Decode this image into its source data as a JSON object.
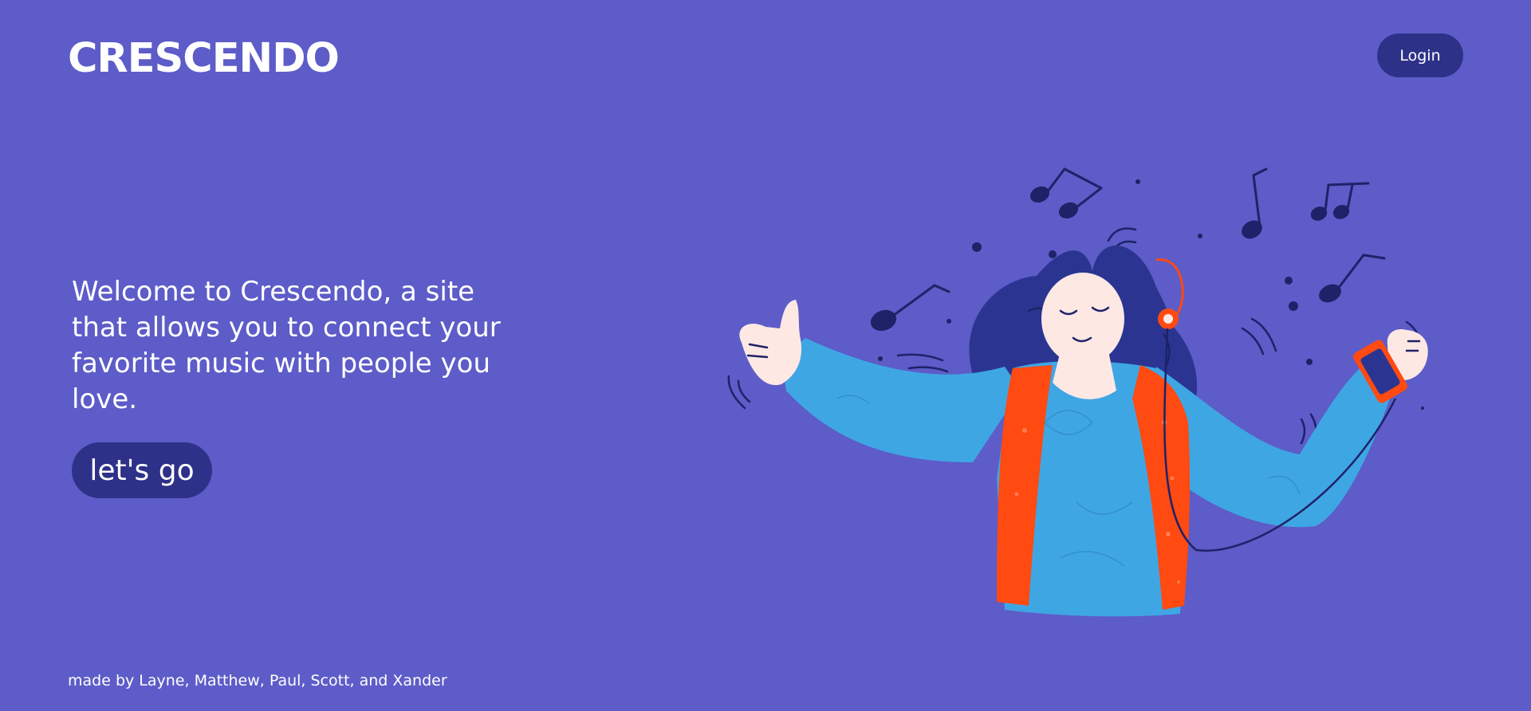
{
  "brand": {
    "name": "CRESCENDO"
  },
  "header": {
    "login_label": "Login"
  },
  "hero": {
    "welcome_text": "Welcome to Crescendo, a site that allows you to connect your favorite music with people you love.",
    "cta_label": "let's go"
  },
  "illustration": {
    "icon": "woman-listening-to-music-illustration"
  },
  "footer": {
    "credits": "made by Layne, Matthew, Paul, Scott, and Xander"
  },
  "colors": {
    "background": "#5d5cc8",
    "button": "#2e3188",
    "text": "#ffffff",
    "sweater": "#3fa6e4",
    "vest": "#ff4a12",
    "hair": "#2b3591",
    "skin": "#fde8e4",
    "notes": "#1e2268"
  }
}
